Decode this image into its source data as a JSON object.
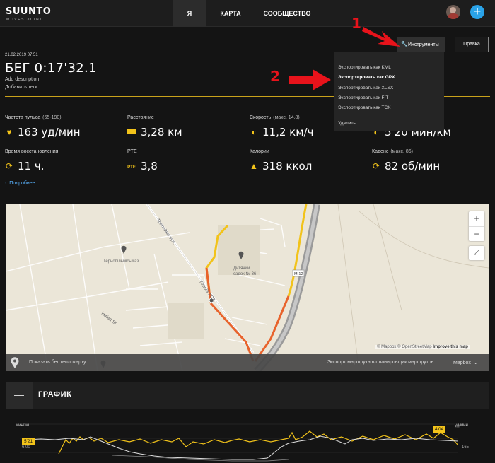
{
  "brand": {
    "name": "SUUNTO",
    "sub": "MOVESCOUNT"
  },
  "nav": {
    "tabs": [
      "Я",
      "КАРТА",
      "СООБЩЕСТВО"
    ]
  },
  "header": {
    "date": "21.02.2019 07:51",
    "title": "БЕГ 0:17'32.1",
    "add_description": "Add description",
    "add_tags": "Добавить теги"
  },
  "toolbar": {
    "tools_label": "Инструменты",
    "edit_label": "Правка"
  },
  "dropdown": {
    "items": [
      "Экспортировать как KML",
      "Экспортировать как GPX",
      "Экспортировать как XLSX",
      "Экспортировать как FIT",
      "Экспортировать как TCX"
    ],
    "delete_label": "Удалить"
  },
  "stats": {
    "heart_rate": {
      "label": "Частота пульса",
      "sub": "(65-190)",
      "value": "163 уд/мин"
    },
    "distance": {
      "label": "Расстояние",
      "value": "3,28 км"
    },
    "speed": {
      "label": "Скорость",
      "sub": "(макс.  14,8)",
      "value": "11,2 км/ч"
    },
    "pace": {
      "value": "5'20 мин/км"
    },
    "recovery": {
      "label": "Время восстановления",
      "value": "11 ч."
    },
    "pte": {
      "label": "PTE",
      "value": "3,8",
      "icon_text": "PTE"
    },
    "calories": {
      "label": "Калории",
      "value": "318 ккол"
    },
    "cadence": {
      "label": "Каденс",
      "sub": "(макс.  86)",
      "value": "82 об/мин"
    }
  },
  "details_link": "Подробнее",
  "map": {
    "labels": {
      "street1": "Тролейна вул.",
      "street2": "Героїв УПА",
      "district": "Тернопільміськгаз",
      "kindergarten1": "Дитячий",
      "kindergarten2": "садок № 36",
      "street3": "Наїва St",
      "road": "М-12"
    },
    "attribution_prefix": "© Mapbox © OpenStreetMap",
    "attribution_link": "Improve this map",
    "footer_left": "Показать бег теплокарту",
    "footer_right": "Экспорт маршрута в планировщик маршрутов",
    "footer_mapbox": "Mapbox"
  },
  "graph": {
    "title": "ГРАФИК",
    "unit_left": "мин/км",
    "unit_right": "уд/мин",
    "pace_tag": "5'21",
    "hr_tag": "4'04",
    "left_value": "6:00",
    "right_value": "165"
  },
  "annotations": [
    "1",
    "2"
  ],
  "colors": {
    "accent": "#f2c31a",
    "route_hot": "#e8632c",
    "route_warm": "#f2c31a",
    "link": "#5ab4ff",
    "arrow": "#e8131b"
  }
}
